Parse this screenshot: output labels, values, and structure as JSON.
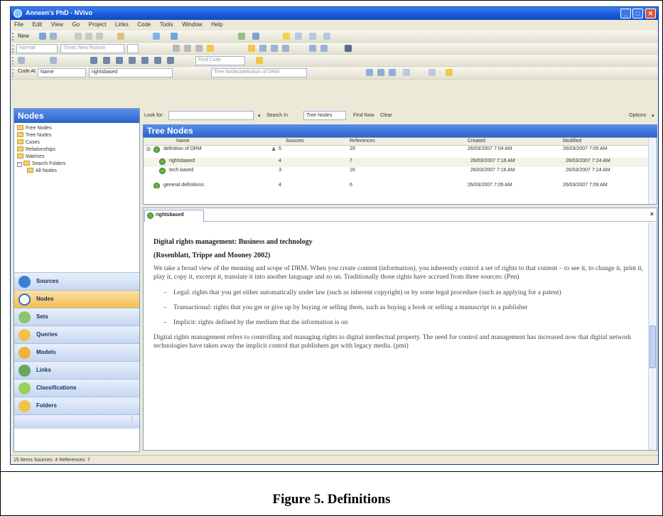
{
  "window": {
    "title": "Anneen's PhD - NVivo"
  },
  "menubar": [
    "File",
    "Edit",
    "View",
    "Go",
    "Project",
    "Links",
    "Code",
    "Tools",
    "Window",
    "Help"
  ],
  "toolbar": {
    "new_label": "New",
    "style_field": "Normal",
    "font_field": "Times New Roman",
    "search_field": "Find Code",
    "code_at_label": "Code At",
    "code_at_field": "Name",
    "code_at_value": "rightsbased",
    "definition_field": "Tree Nodes\\definition of DRM"
  },
  "left_panel": {
    "header": "Nodes",
    "tree": [
      "Free Nodes",
      "Tree Nodes",
      "Cases",
      "Relationships",
      "Matrices",
      "Search Folders",
      "All Nodes"
    ],
    "nav": [
      "Sources",
      "Nodes",
      "Sets",
      "Queries",
      "Models",
      "Links",
      "Classifications",
      "Folders"
    ],
    "nav_active": "Nodes"
  },
  "find_bar": {
    "look_for_label": "Look for:",
    "search_in_label": "Search In",
    "search_in_value": "Tree Nodes",
    "find_now": "Find Now",
    "clear": "Clear",
    "options": "Options"
  },
  "list": {
    "header": "Tree Nodes",
    "columns": [
      "Name",
      "Sources",
      "References",
      "Created",
      "Modified"
    ],
    "rows": [
      {
        "name": "definition of DRM",
        "sources": "5",
        "references": "29",
        "created": "26/03/2007 7:04 AM",
        "modified": "26/03/2007 7:05 AM"
      },
      {
        "name": "rightsbased",
        "sources": "4",
        "references": "7",
        "created": "26/03/2007 7:16 AM",
        "modified": "26/03/2007 7:24 AM"
      },
      {
        "name": "tech based",
        "sources": "3",
        "references": "16",
        "created": "26/03/2007 7:16 AM",
        "modified": "26/03/2007 7:24 AM"
      },
      {
        "name": "general definitions",
        "sources": "4",
        "references": "6",
        "created": "26/03/2007 7:05 AM",
        "modified": "26/03/2007 7:09 AM"
      }
    ]
  },
  "document": {
    "tab": "rightsbased",
    "heading1": "Digital rights management: Business and technology",
    "heading2": "(Rosenblatt, Trippe and Mooney 2002)",
    "para1": "We take a broad view of the meaning and scope of DRM. When you create content (information), you inherently control a set of rights to that content – to see it, to change it, print it, play it, copy it, excerpt it, translate it into another language and so on. Traditionally those rights have accrued from three sources: (Pen)",
    "bullets": [
      "Legal: rights that you get either automatically under law (such as inherent copyright) or by some legal procedure (such as applying for a patent)",
      "Transactional: rights that you get or give up by buying or selling them, such as buying a book or selling a manuscript to a publisher",
      "Implicit: rights defined by the medium that the information is on"
    ],
    "para2": "Digital rights management refers to controlling and managing rights to digital intellectual property. The need for control and management has increased now that digital network technologies have taken away the implicit control that publishers get with legacy media. (pmi)"
  },
  "status": "15 Items  Sources: 4  References: 7",
  "caption": "Figure 5.  Definitions",
  "colors": {
    "titlebar": "#1c5bd8",
    "panel_header": "#2c64cc",
    "nav_active": "#f5bd4d"
  }
}
